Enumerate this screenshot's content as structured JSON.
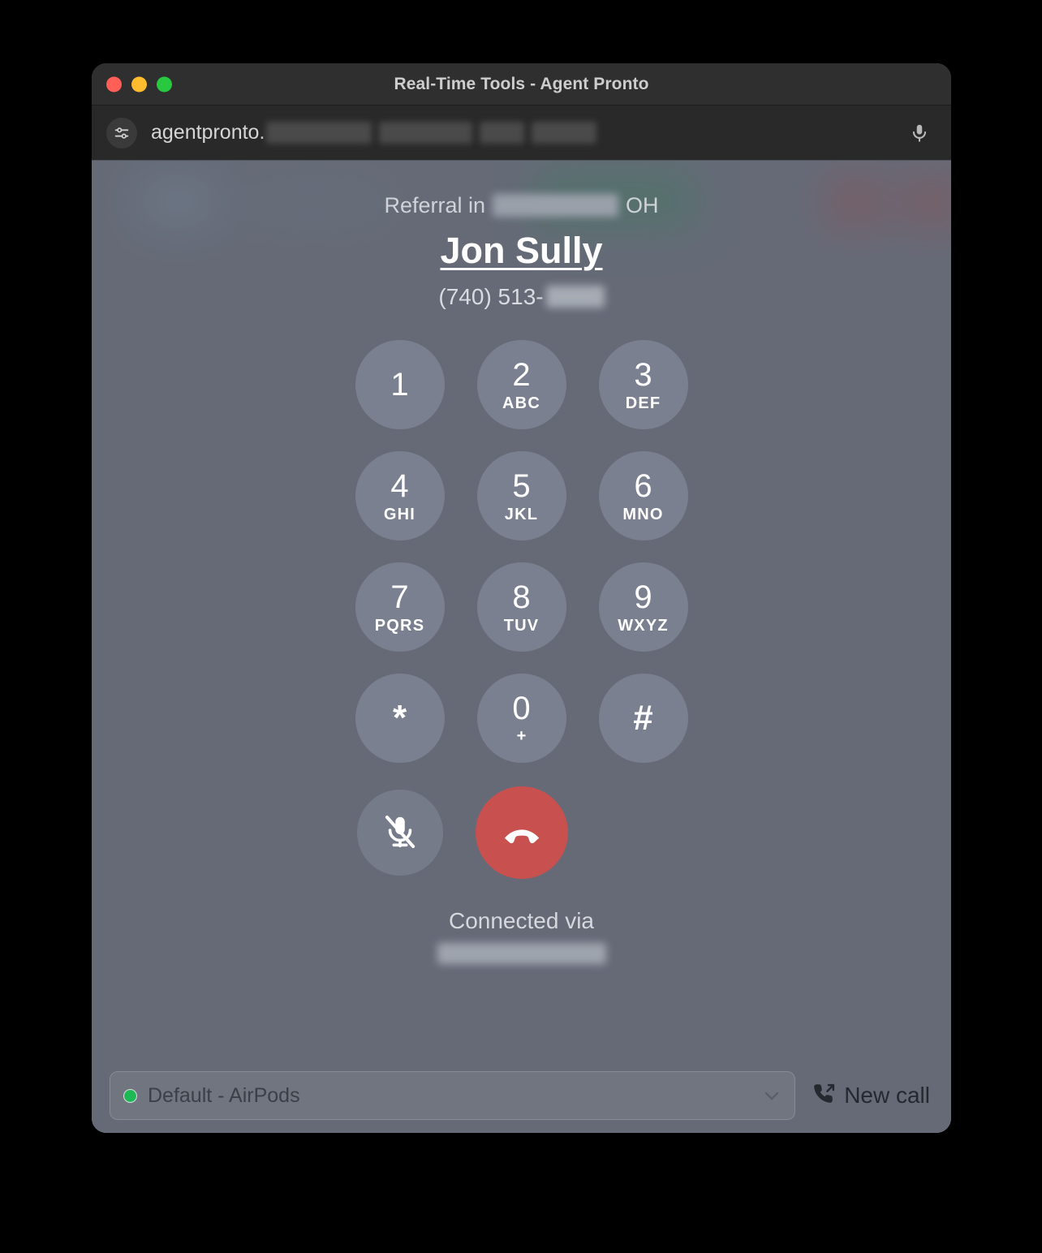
{
  "window": {
    "title": "Real-Time Tools - Agent Pronto",
    "traffic_lights": {
      "close": "close-button",
      "minimize": "minimize-button",
      "zoom": "zoom-button"
    }
  },
  "urlbar": {
    "url_visible": "agentpronto.",
    "site_settings_icon": "sliders-icon",
    "mic_icon": "microphone-icon",
    "redacted_segments": [
      130,
      115,
      55,
      80
    ]
  },
  "contact": {
    "referral_prefix": "Referral in",
    "referral_state": "OH",
    "name": "Jon Sully",
    "phone_visible": "(740) 513-"
  },
  "keypad": {
    "keys": [
      {
        "digit": "1",
        "letters": ""
      },
      {
        "digit": "2",
        "letters": "ABC"
      },
      {
        "digit": "3",
        "letters": "DEF"
      },
      {
        "digit": "4",
        "letters": "GHI"
      },
      {
        "digit": "5",
        "letters": "JKL"
      },
      {
        "digit": "6",
        "letters": "MNO"
      },
      {
        "digit": "7",
        "letters": "PQRS"
      },
      {
        "digit": "8",
        "letters": "TUV"
      },
      {
        "digit": "9",
        "letters": "WXYZ"
      },
      {
        "digit": "*",
        "letters": ""
      },
      {
        "digit": "0",
        "letters": "+"
      },
      {
        "digit": "#",
        "letters": ""
      }
    ]
  },
  "controls": {
    "mute_icon": "microphone-off-icon",
    "hangup_icon": "phone-hangup-icon",
    "hangup_color": "#c8504f"
  },
  "status": {
    "connected_label": "Connected via"
  },
  "bottombar": {
    "device_label": "Default - AirPods",
    "device_status_color": "#1db954",
    "chevron_icon": "chevron-down-icon",
    "newcall_label": "New call",
    "newcall_icon": "phone-outgoing-icon"
  }
}
